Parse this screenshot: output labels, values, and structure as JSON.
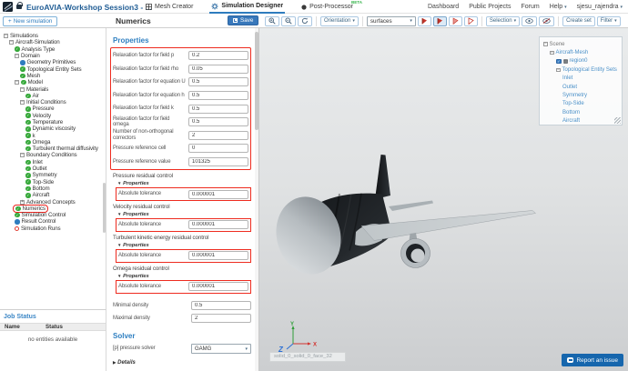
{
  "header": {
    "app_title": "EuroAVIA-Workshop Session3 - ...",
    "tabs": [
      {
        "label": "Mesh Creator",
        "active": false
      },
      {
        "label": "Simulation Designer",
        "active": true
      },
      {
        "label": "Post-Processor",
        "active": false,
        "badge": "BETA"
      }
    ],
    "nav_links": [
      "Dashboard",
      "Public Projects",
      "Forum"
    ],
    "help_label": "Help",
    "user_name": "sjesu_rajendra"
  },
  "action_bar": {
    "new_simulation_label": "New simulation",
    "panel_title": "Numerics",
    "save_label": "Save",
    "orientation_label": "Orientation",
    "surfaces_value": "surfaces",
    "selection_label": "Selection",
    "create_set_label": "Create set",
    "filter_label": "Filter"
  },
  "simulation_tree": {
    "items": [
      {
        "label": "Simulations",
        "level": 0,
        "expander": "open"
      },
      {
        "label": "Aircraft-Simulation",
        "level": 1,
        "expander": "open"
      },
      {
        "label": "Analysis Type",
        "level": 2,
        "icon": "check"
      },
      {
        "label": "Domain",
        "level": 2,
        "expander": "open"
      },
      {
        "label": "Geometry Primitives",
        "level": 3,
        "icon": "dot"
      },
      {
        "label": "Topological Entity Sets",
        "level": 3,
        "icon": "check"
      },
      {
        "label": "Mesh",
        "level": 3,
        "icon": "check"
      },
      {
        "label": "Model",
        "level": 2,
        "expander": "open",
        "icon": "check"
      },
      {
        "label": "Materials",
        "level": 3,
        "expander": "open"
      },
      {
        "label": "Air",
        "level": 4,
        "icon": "check"
      },
      {
        "label": "Initial Conditions",
        "level": 3,
        "expander": "open"
      },
      {
        "label": "Pressure",
        "level": 4,
        "icon": "check"
      },
      {
        "label": "Velocity",
        "level": 4,
        "icon": "check"
      },
      {
        "label": "Temperature",
        "level": 4,
        "icon": "check"
      },
      {
        "label": "Dynamic viscosity",
        "level": 4,
        "icon": "check"
      },
      {
        "label": "k",
        "level": 4,
        "icon": "check"
      },
      {
        "label": "Omega",
        "level": 4,
        "icon": "check"
      },
      {
        "label": "Turbulent thermal diffusivity",
        "level": 4,
        "icon": "check"
      },
      {
        "label": "Boundary Conditions",
        "level": 3,
        "expander": "open"
      },
      {
        "label": "Inlet",
        "level": 4,
        "icon": "check"
      },
      {
        "label": "Outlet",
        "level": 4,
        "icon": "check"
      },
      {
        "label": "Symmetry",
        "level": 4,
        "icon": "check"
      },
      {
        "label": "Top-Side",
        "level": 4,
        "icon": "check"
      },
      {
        "label": "Bottom",
        "level": 4,
        "icon": "check"
      },
      {
        "label": "Aircraft",
        "level": 4,
        "icon": "check"
      },
      {
        "label": "Advanced Concepts",
        "level": 3,
        "expander": "closed"
      },
      {
        "label": "Numerics",
        "level": 2,
        "icon": "check",
        "selected": true
      },
      {
        "label": "Simulation Control",
        "level": 2,
        "icon": "check"
      },
      {
        "label": "Result Control",
        "level": 2,
        "icon": "dot"
      },
      {
        "label": "Simulation Runs",
        "level": 2,
        "icon": "circle"
      }
    ]
  },
  "numerics_panel": {
    "properties_heading": "Properties",
    "main_fields": [
      {
        "label": "Relaxation factor for field p",
        "value": "0.2"
      },
      {
        "label": "Relaxation factor for field rho",
        "value": "0.05"
      },
      {
        "label": "Relaxation factor for equation U",
        "value": "0.5"
      },
      {
        "label": "Relaxation factor for equation h",
        "value": "0.5"
      },
      {
        "label": "Relaxation factor for field k",
        "value": "0.5"
      },
      {
        "label": "Relaxation factor for field omega",
        "value": "0.5"
      },
      {
        "label": "Number of non-orthogonal correctors",
        "value": "2"
      },
      {
        "label": "Pressure reference cell",
        "value": "0"
      },
      {
        "label": "Pressure reference value",
        "value": "101325"
      }
    ],
    "residual_groups": [
      {
        "title": "Pressure residual control",
        "sub_heading": "Properties",
        "field_label": "Absolute tolerance",
        "value": "0.000001"
      },
      {
        "title": "Velocity residual control",
        "sub_heading": "Properties",
        "field_label": "Absolute tolerance",
        "value": "0.000001"
      },
      {
        "title": "Turbulent kinetic energy residual control",
        "sub_heading": "Properties",
        "field_label": "Absolute tolerance",
        "value": "0.000001"
      },
      {
        "title": "Omega residual control",
        "sub_heading": "Properties",
        "field_label": "Absolute tolerance",
        "value": "0.000001"
      }
    ],
    "density_fields": [
      {
        "label": "Minimal density",
        "value": "0.5"
      },
      {
        "label": "Maximal density",
        "value": "2"
      }
    ],
    "solver_heading": "Solver",
    "solver_field": {
      "label": "[p] pressure solver",
      "value": "GAMG"
    },
    "details_label": "Details"
  },
  "job_status": {
    "heading": "Job Status",
    "columns": [
      "Name",
      "Status"
    ],
    "empty_message": "no entities available"
  },
  "scene_tree": {
    "items": [
      {
        "label": "Scene",
        "level": 0,
        "expander": true,
        "color": "gray"
      },
      {
        "label": "Aircraft-Mesh",
        "level": 1,
        "expander": true
      },
      {
        "label": "region0",
        "level": 2,
        "checkbox": true
      },
      {
        "label": "Topological Entity Sets",
        "level": 2,
        "expander": true
      },
      {
        "label": "Inlet",
        "level": 3
      },
      {
        "label": "Outlet",
        "level": 3
      },
      {
        "label": "Symmetry",
        "level": 3
      },
      {
        "label": "Top-Side",
        "level": 3
      },
      {
        "label": "Bottom",
        "level": 3
      },
      {
        "label": "Aircraft",
        "level": 3
      }
    ]
  },
  "viewport": {
    "face_hint": "solid_0_solid_0_face_32",
    "report_issue_label": "Report an issue",
    "axes": {
      "x": "X",
      "y": "Y",
      "z": "Z"
    }
  },
  "icons": {
    "chevron_down": "▾",
    "triangle_down": "▼",
    "triangle_right": "▶",
    "plus": "+",
    "expander_open": "−",
    "expander_closed": "+",
    "check": "✓"
  },
  "colors": {
    "accent_blue": "#2e7cbe",
    "annotation_red": "#ee2b1f",
    "check_green": "#35a839",
    "link_blue": "#4a90c8",
    "report_button_blue": "#1666ad"
  }
}
